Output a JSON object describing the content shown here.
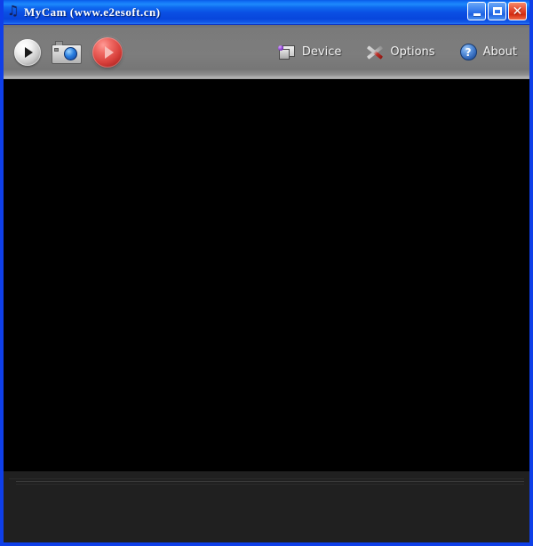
{
  "window": {
    "title": "MyCam (www.e2esoft.cn)",
    "icon_name": "mycam-app-icon",
    "border_color": "#0f3fe8",
    "titlebar_color": "#0a50e4"
  },
  "window_controls": {
    "minimize_label": "_",
    "maximize_label": "",
    "close_label": "✕",
    "close_color": "#d32b10"
  },
  "toolbar": {
    "background_color": "#7d7d7d",
    "left_buttons": [
      {
        "name": "preview-play-button",
        "label": "",
        "icon": "play-icon",
        "color": "#e8e8e8"
      },
      {
        "name": "snapshot-button",
        "label": "",
        "icon": "camera-icon",
        "color": "#d3d3d3"
      },
      {
        "name": "record-button",
        "label": "",
        "icon": "record-play-icon",
        "color": "#d8413c"
      }
    ],
    "menu_items": [
      {
        "name": "device-menu",
        "label": "Device",
        "icon": "device-icon"
      },
      {
        "name": "options-menu",
        "label": "Options",
        "icon": "tools-icon"
      },
      {
        "name": "about-menu",
        "label": "About",
        "icon": "question-circle-icon"
      }
    ]
  },
  "video": {
    "name": "video-preview-area",
    "background_color": "#000000",
    "content": ""
  },
  "status_panel": {
    "name": "bottom-status-panel",
    "background_color": "#202020",
    "text": ""
  }
}
